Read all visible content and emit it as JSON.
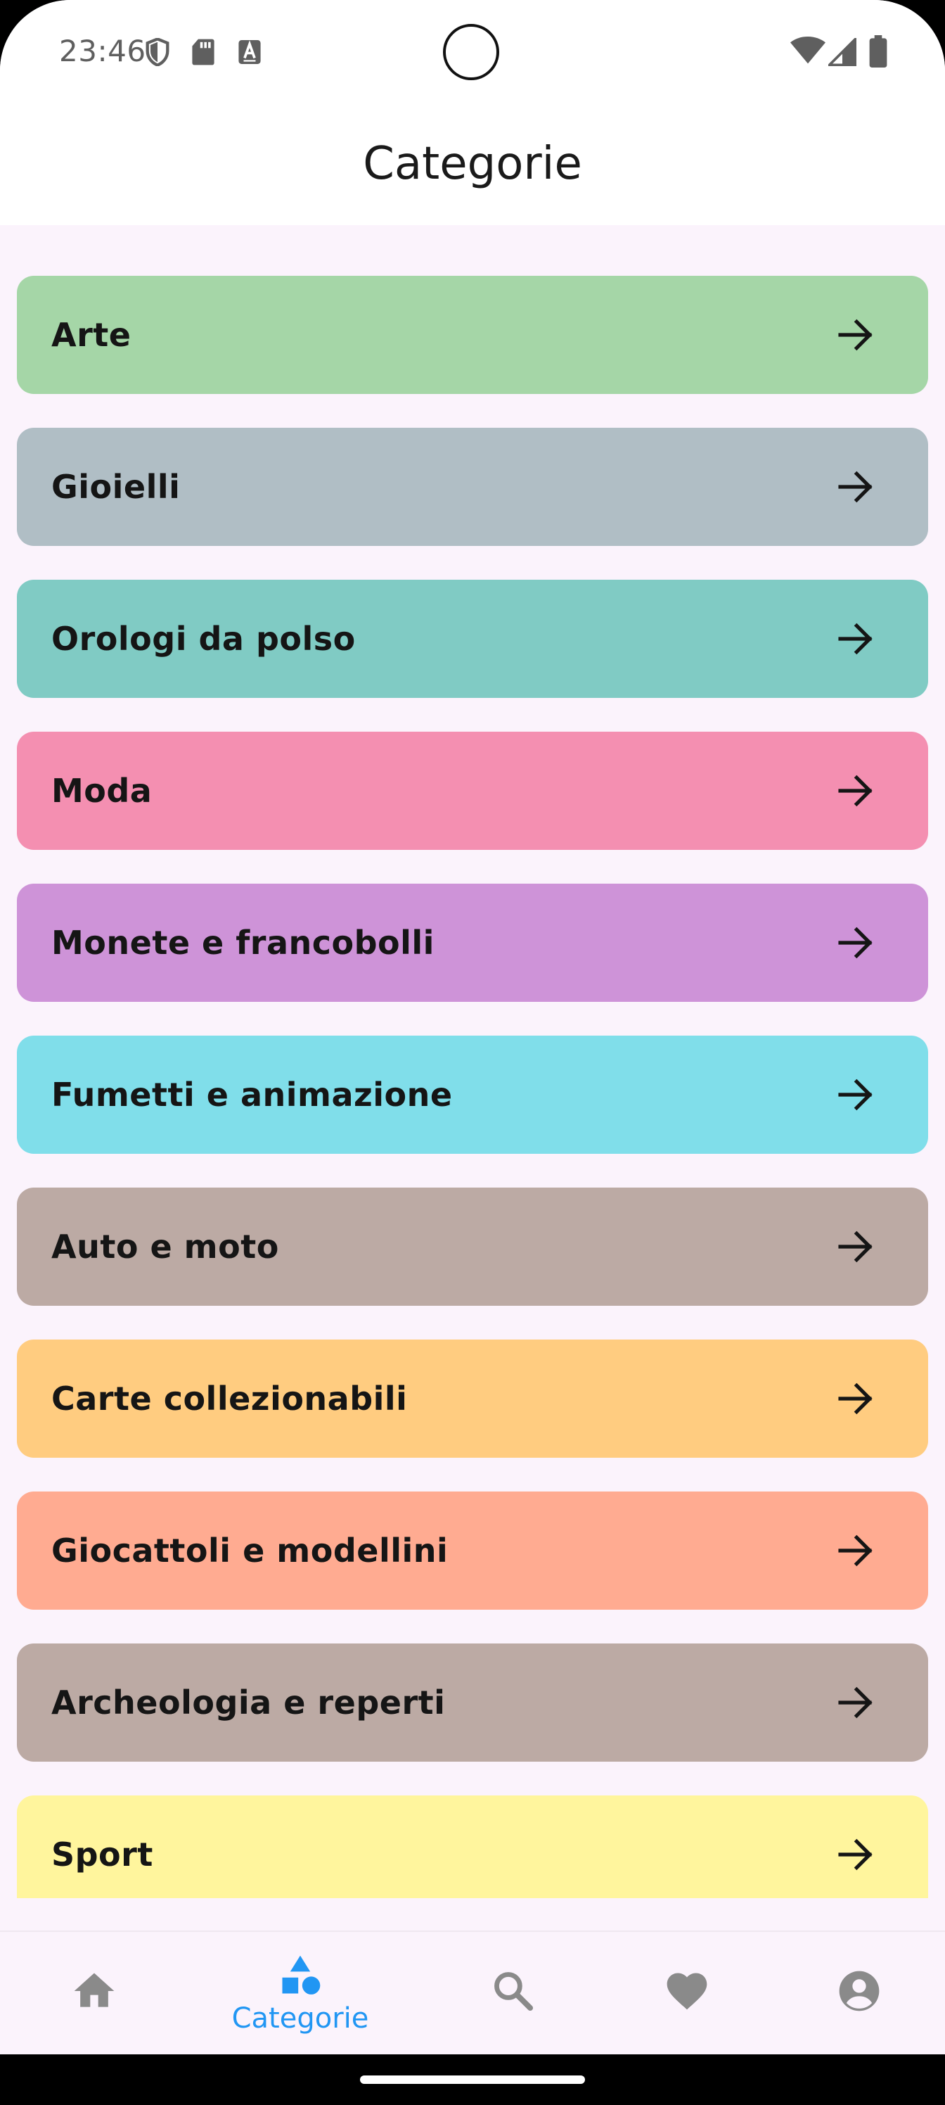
{
  "status_bar": {
    "time": "23:46",
    "left_icons": [
      "shield-icon",
      "sd-card-icon",
      "keyboard-a-icon"
    ],
    "right_icons": [
      "wifi-icon",
      "cell-signal-icon",
      "battery-icon"
    ]
  },
  "header": {
    "title": "Categorie"
  },
  "categories": [
    {
      "label": "Arte",
      "color": "#a5d6a7"
    },
    {
      "label": "Gioielli",
      "color": "#b0bec5"
    },
    {
      "label": "Orologi da polso",
      "color": "#80cbc4"
    },
    {
      "label": "Moda",
      "color": "#f48fb1"
    },
    {
      "label": "Monete e francobolli",
      "color": "#ce93d8"
    },
    {
      "label": "Fumetti e animazione",
      "color": "#80deea"
    },
    {
      "label": "Auto e moto",
      "color": "#bcaaa4"
    },
    {
      "label": "Carte collezionabili",
      "color": "#ffcc80"
    },
    {
      "label": "Giocattoli e modellini",
      "color": "#ffab91"
    },
    {
      "label": "Archeologia e reperti",
      "color": "#bcaaa4"
    },
    {
      "label": "Sport",
      "color": "#fff59d"
    }
  ],
  "bottom_nav": {
    "items": [
      {
        "icon": "home-icon",
        "label": "",
        "active": false
      },
      {
        "icon": "category-shapes-icon",
        "label": "Categorie",
        "active": true
      },
      {
        "icon": "search-icon",
        "label": "",
        "active": false
      },
      {
        "icon": "heart-icon",
        "label": "",
        "active": false
      },
      {
        "icon": "account-circle-icon",
        "label": "",
        "active": false
      }
    ]
  },
  "colors": {
    "accent": "#2196f3",
    "nav_inactive": "#8a8a8a",
    "background": "#fbf3fc"
  }
}
